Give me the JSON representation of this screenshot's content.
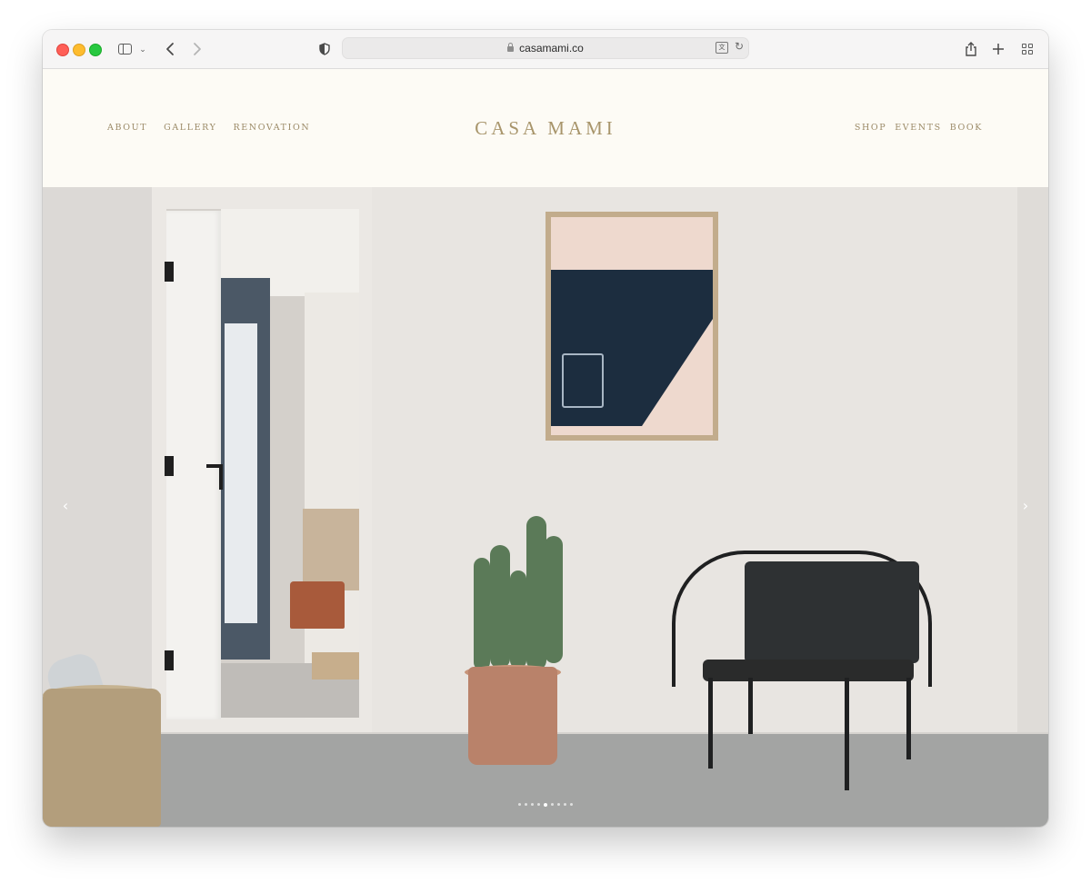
{
  "browser": {
    "url": "casamami.co",
    "icons": [
      "close-icon",
      "minimize-icon",
      "zoom-icon",
      "sidebar-icon",
      "chevron-down-icon",
      "back-icon",
      "forward-icon",
      "shield-icon",
      "lock-icon",
      "translate-icon",
      "reload-icon",
      "share-icon",
      "plus-icon",
      "tab-overview-icon"
    ]
  },
  "site": {
    "brand": "CASA MAMI",
    "nav_left": [
      "ABOUT",
      "GALLERY",
      "RENOVATION"
    ],
    "nav_right": [
      "SHOP",
      "EVENTS",
      "BOOK"
    ],
    "colors": {
      "accent": "#a8956b",
      "header_bg": "#fdfbf5"
    }
  },
  "hero": {
    "prev_label": "‹",
    "next_label": "›",
    "slide_count": 9,
    "active_slide": 5
  }
}
